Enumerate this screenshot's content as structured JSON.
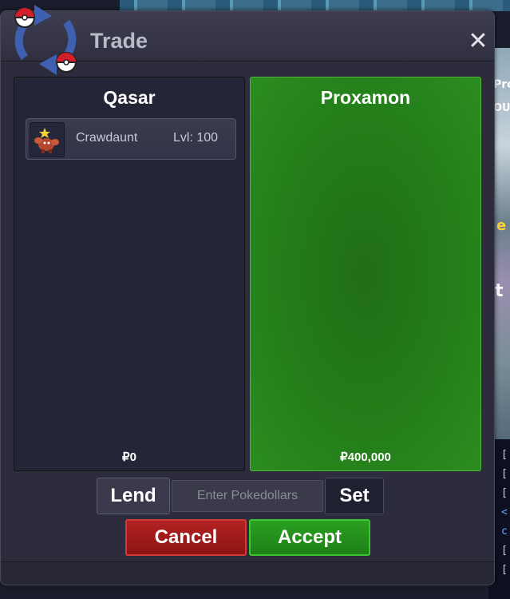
{
  "window": {
    "title": "Trade"
  },
  "left_party": {
    "name": "Qasar",
    "money": "₽0",
    "items": [
      {
        "name": "Crawdaunt",
        "level": "Lvl: 100"
      }
    ]
  },
  "right_party": {
    "name": "Proxamon",
    "money": "₽400,000"
  },
  "controls": {
    "lend_label": "Lend",
    "pokedollars_placeholder": "Enter Pokedollars",
    "set_label": "Set",
    "cancel_label": "Cancel",
    "accept_label": "Accept"
  },
  "background": {
    "right_edge_text": [
      "Pro",
      "OU",
      "e",
      "t"
    ],
    "chat_brackets": [
      "[",
      "[",
      "[",
      "<",
      "c",
      "[",
      "["
    ]
  },
  "colors": {
    "accept_green": "#2aa021",
    "cancel_red": "#b32222",
    "offer_panel_green": "#247f1a"
  }
}
